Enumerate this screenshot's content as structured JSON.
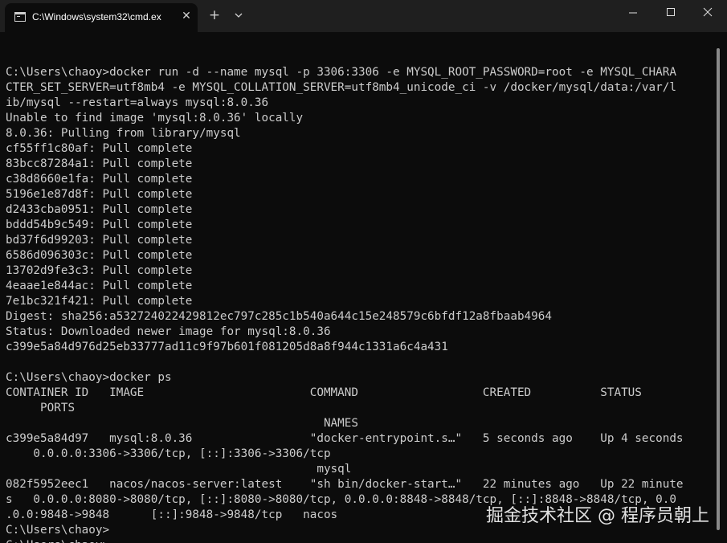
{
  "tab": {
    "title": "C:\\Windows\\system32\\cmd.ex",
    "close_glyph": "✕",
    "new_tab_glyph": "+"
  },
  "icons": {
    "app": "console-icon",
    "tab_close": "close-icon",
    "new_tab": "plus-icon",
    "dropdown": "chevron-down-icon",
    "minimize": "minimize-icon",
    "maximize": "maximize-icon",
    "close": "close-icon"
  },
  "colors": {
    "background": "#0c0c0c",
    "titlebar": "#1f1f1f",
    "text": "#cccccc"
  },
  "terminal": {
    "lines": [
      "",
      "C:\\Users\\chaoy>docker run -d --name mysql -p 3306:3306 -e MYSQL_ROOT_PASSWORD=root -e MYSQL_CHARA",
      "CTER_SET_SERVER=utf8mb4 -e MYSQL_COLLATION_SERVER=utf8mb4_unicode_ci -v /docker/mysql/data:/var/l",
      "ib/mysql --restart=always mysql:8.0.36",
      "Unable to find image 'mysql:8.0.36' locally",
      "8.0.36: Pulling from library/mysql",
      "cf55ff1c80af: Pull complete",
      "83bcc87284a1: Pull complete",
      "c38d8660e1fa: Pull complete",
      "5196e1e87d8f: Pull complete",
      "d2433cba0951: Pull complete",
      "bddd54b9c549: Pull complete",
      "bd37f6d99203: Pull complete",
      "6586d096303c: Pull complete",
      "13702d9fe3c3: Pull complete",
      "4eaae1e844ac: Pull complete",
      "7e1bc321f421: Pull complete",
      "Digest: sha256:a532724022429812ec797c285c1b540a644c15e248579c6bfdf12a8fbaab4964",
      "Status: Downloaded newer image for mysql:8.0.36",
      "c399e5a84d976d25eb33777ad11c9f97b601f081205d8a8f944c1331a6c4a431",
      "",
      "C:\\Users\\chaoy>docker ps",
      "CONTAINER ID   IMAGE                        COMMAND                  CREATED          STATUS",
      "     PORTS",
      "                                              NAMES",
      "c399e5a84d97   mysql:8.0.36                 \"docker-entrypoint.s…\"   5 seconds ago    Up 4 seconds",
      "    0.0.0.0:3306->3306/tcp, [::]:3306->3306/tcp",
      "                                             mysql",
      "082f5952eec1   nacos/nacos-server:latest    \"sh bin/docker-start…\"   22 minutes ago   Up 22 minute",
      "s   0.0.0.0:8080->8080/tcp, [::]:8080->8080/tcp, 0.0.0.0:8848->8848/tcp, [::]:8848->8848/tcp, 0.0",
      ".0.0:9848->9848      [::]:9848->9848/tcp   nacos",
      "C:\\Users\\chaoy>",
      "C:\\Users\\chaoy>"
    ]
  },
  "watermark": {
    "text": "掘金技术社区 @ 程序员朝上"
  }
}
